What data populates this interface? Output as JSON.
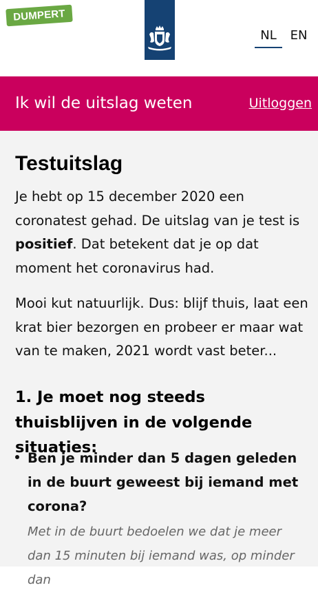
{
  "watermark": {
    "text": "DUMPERT"
  },
  "header": {
    "logo_icon": "rijksoverheid-coat-of-arms-icon",
    "lang_nl": "NL",
    "lang_en": "EN",
    "active_lang": "NL"
  },
  "banner": {
    "title": "Ik wil de uitslag weten",
    "logout": "Uitloggen"
  },
  "main": {
    "heading": "Testuitslag",
    "p1_before": "Je hebt op 15 december 2020 een coronatest gehad. De uitslag van je test is ",
    "p1_bold": "positief",
    "p1_after": ". Dat betekent dat je op dat moment het coronavirus had.",
    "p2": "Mooi kut natuurlijk. Dus: blijf thuis, laat een krat bier bezorgen en probeer er maar wat van te maken, 2021 wordt vast beter...",
    "section_heading": "1. Je moet nog steeds thuisblijven in de volgende situaties:",
    "bullets": [
      {
        "question": "Ben je minder dan 5 dagen geleden in de buurt geweest bij iemand met corona?",
        "note": "Met in de buurt bedoelen we dat je meer dan 15 minuten bij iemand was, op minder dan"
      }
    ]
  },
  "colors": {
    "banner": "#ca005d",
    "logo": "#154273",
    "dumpert": "#6aa843",
    "content_bg": "#f3f3f3"
  }
}
